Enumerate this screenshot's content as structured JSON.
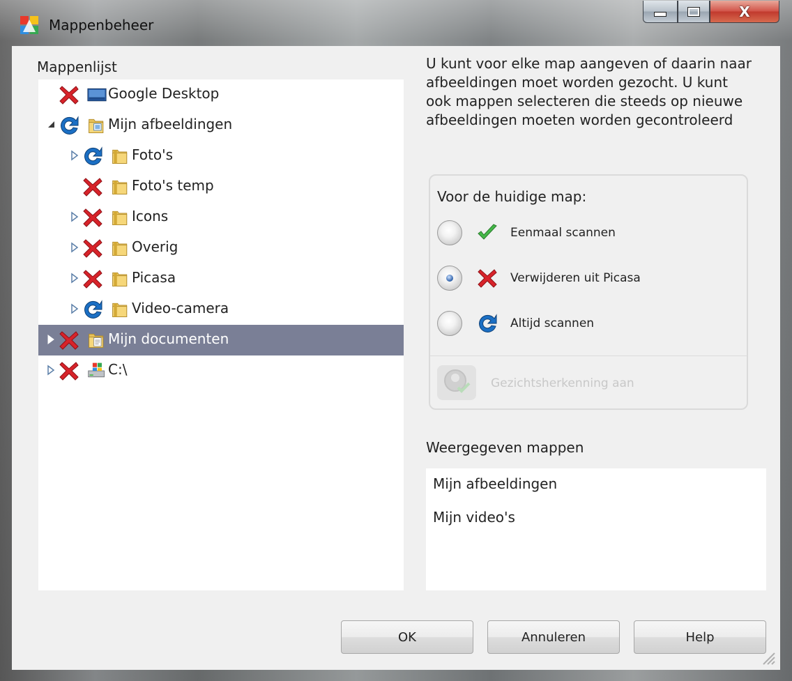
{
  "window": {
    "title": "Mappenbeheer"
  },
  "caption_buttons": {
    "close_glyph": "X"
  },
  "folder_list": {
    "label": "Mappenlijst",
    "items": [
      {
        "label": "Google Desktop",
        "status": "remove",
        "expander": "none",
        "icon": "desktop-icon",
        "depth": 0,
        "selected": false
      },
      {
        "label": "Mijn afbeeldingen",
        "status": "always-scan",
        "expander": "expanded",
        "icon": "pictures-folder-icon",
        "depth": 0,
        "selected": false
      },
      {
        "label": "Foto's",
        "status": "always-scan",
        "expander": "collapsed",
        "icon": "folder-icon",
        "depth": 1,
        "selected": false
      },
      {
        "label": "Foto's temp",
        "status": "remove",
        "expander": "none",
        "icon": "folder-icon",
        "depth": 1,
        "selected": false
      },
      {
        "label": "Icons",
        "status": "remove",
        "expander": "collapsed",
        "icon": "folder-icon",
        "depth": 1,
        "selected": false
      },
      {
        "label": "Overig",
        "status": "remove",
        "expander": "collapsed",
        "icon": "folder-icon",
        "depth": 1,
        "selected": false
      },
      {
        "label": "Picasa",
        "status": "remove",
        "expander": "collapsed",
        "icon": "folder-icon",
        "depth": 1,
        "selected": false
      },
      {
        "label": "Video-camera",
        "status": "always-scan",
        "expander": "collapsed",
        "icon": "folder-icon",
        "depth": 1,
        "selected": false
      },
      {
        "label": "Mijn documenten",
        "status": "remove",
        "expander": "collapsed",
        "icon": "documents-folder-icon",
        "depth": 0,
        "selected": true
      },
      {
        "label": "C:\\",
        "status": "remove",
        "expander": "collapsed",
        "icon": "drive-icon",
        "depth": 0,
        "selected": false
      }
    ]
  },
  "description": "U kunt voor elke map aangeven of daarin naar afbeeldingen moet worden gezocht. U kunt ook mappen selecteren die steeds op nieuwe afbeeldingen moeten worden gecontroleerd",
  "current_folder": {
    "label": "Voor de huidige map:",
    "options": [
      {
        "label": "Eenmaal scannen",
        "icon": "checkmark-icon",
        "checked": false
      },
      {
        "label": "Verwijderen uit Picasa",
        "icon": "red-x-icon",
        "checked": true
      },
      {
        "label": "Altijd scannen",
        "icon": "refresh-icon",
        "checked": false
      }
    ],
    "face_recognition": {
      "label": "Gezichtsherkenning aan",
      "enabled": false
    }
  },
  "shown_folders": {
    "label": "Weergegeven mappen",
    "items": [
      "Mijn afbeeldingen",
      "Mijn video's"
    ]
  },
  "buttons": {
    "ok": "OK",
    "cancel": "Annuleren",
    "help": "Help"
  },
  "colors": {
    "selection": "#7a7f96",
    "remove_red": "#d8232a",
    "scan_blue": "#1b6fc4",
    "check_green": "#3aa83a"
  }
}
